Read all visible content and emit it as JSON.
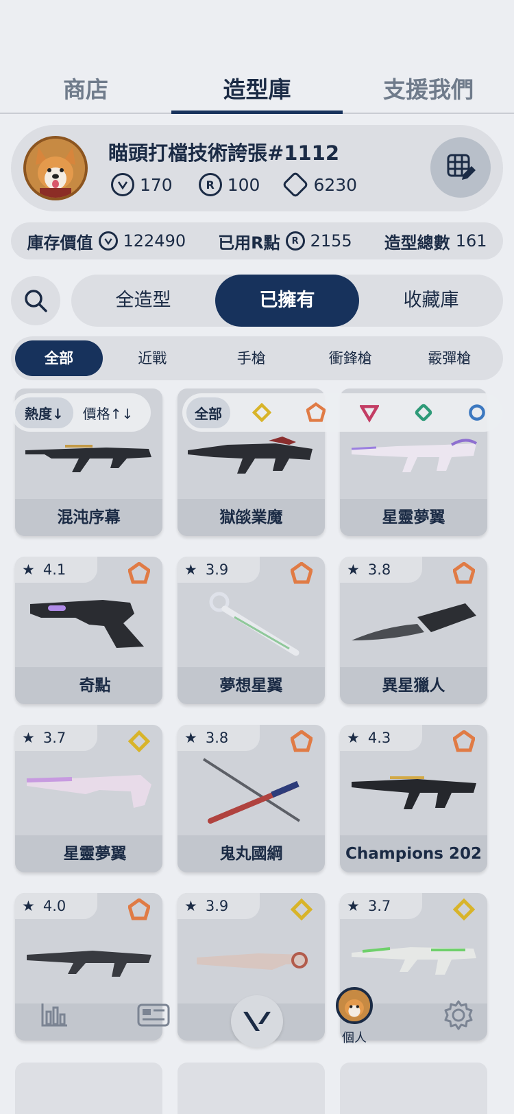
{
  "top_tabs": [
    {
      "label": "商店"
    },
    {
      "label": "造型庫"
    },
    {
      "label": "支援我們"
    }
  ],
  "profile": {
    "username": "瞄頭打檔技術誇張#1112",
    "valorant_points": "170",
    "radianite_points": "100",
    "kingdom_credits": "6230"
  },
  "stats": {
    "inventory_value_label": "庫存價值",
    "inventory_value": "122490",
    "used_r_label": "已用R點",
    "used_r": "2155",
    "skin_total_label": "造型總數",
    "skin_total": "161"
  },
  "filter_tabs": [
    {
      "label": "全造型"
    },
    {
      "label": "已擁有"
    },
    {
      "label": "收藏庫"
    }
  ],
  "type_tabs": [
    {
      "label": "全部"
    },
    {
      "label": "近戰"
    },
    {
      "label": "手槍"
    },
    {
      "label": "衝鋒槍"
    },
    {
      "label": "霰彈槍"
    }
  ],
  "sort": {
    "popularity": "熱度↓",
    "price": "價格↑↓"
  },
  "tier_filter": {
    "all": "全部"
  },
  "colors": {
    "navy": "#17325c",
    "select": "#d8b42a",
    "deluxe": "#e07b45",
    "premium": "#c33d64",
    "exclusive": "#2e9a78",
    "ultra": "#3c78c0"
  },
  "cards": [
    {
      "name": "混沌序幕",
      "rating": ""
    },
    {
      "name": "獄燄業魔",
      "rating": ""
    },
    {
      "name": "星靈夢翼",
      "rating": ""
    },
    {
      "name": "奇點",
      "rating": "4.1",
      "tier": "deluxe"
    },
    {
      "name": "夢想星翼",
      "rating": "3.9",
      "tier": "deluxe"
    },
    {
      "name": "異星獵人",
      "rating": "3.8",
      "tier": "deluxe"
    },
    {
      "name": "星靈夢翼",
      "rating": "3.7",
      "tier": "select"
    },
    {
      "name": "鬼丸國綱",
      "rating": "3.8",
      "tier": "deluxe"
    },
    {
      "name": "Champions 202",
      "rating": "4.3",
      "tier": "deluxe"
    },
    {
      "name": "",
      "rating": "4.0",
      "tier": "deluxe"
    },
    {
      "name": "",
      "rating": "3.9",
      "tier": "select"
    },
    {
      "name": "",
      "rating": "3.7",
      "tier": "select"
    }
  ],
  "bottom_nav": {
    "profile_label": "個人"
  }
}
